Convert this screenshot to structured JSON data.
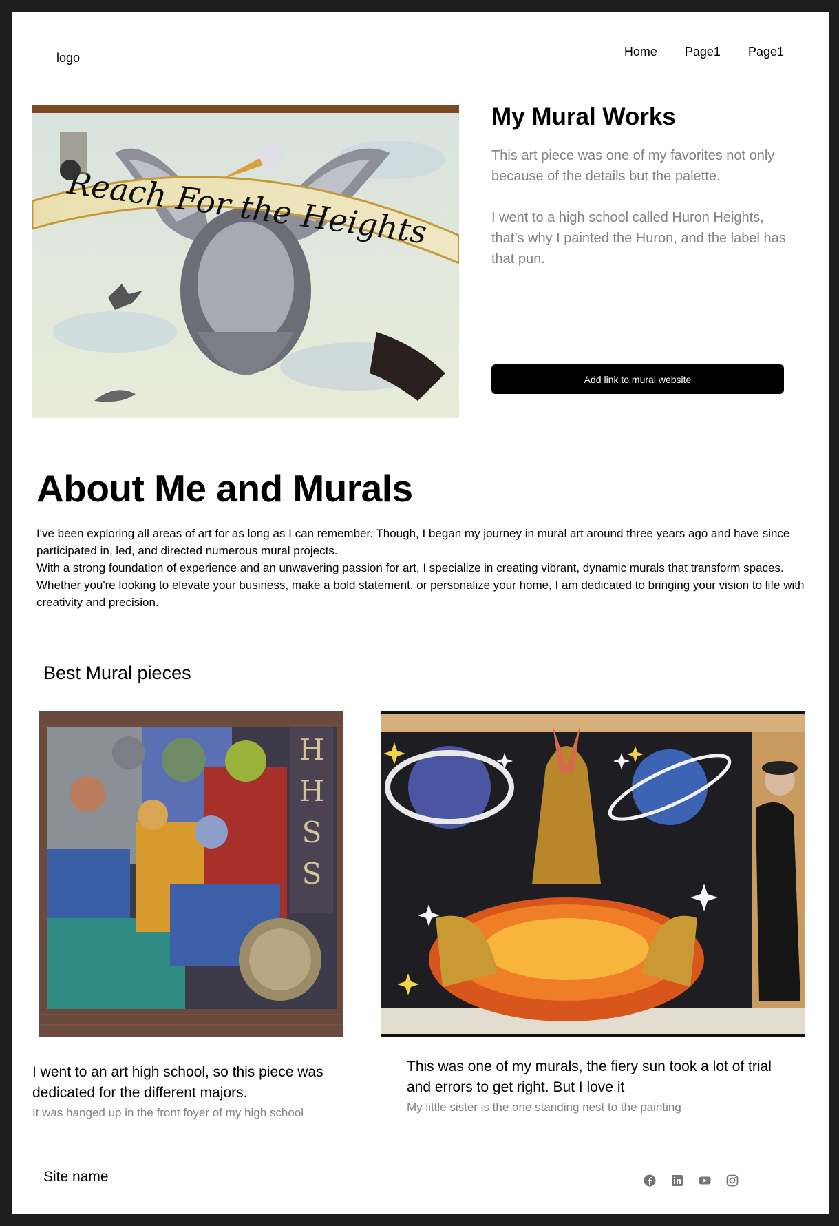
{
  "header": {
    "logo": "logo",
    "nav": [
      "Home",
      "Page1",
      "Page1"
    ]
  },
  "hero": {
    "image_text": "Reach For the Heights",
    "title": "My Mural Works",
    "paragraphs": [
      "This art piece was one of my favorites not only because of the details but the palette.",
      "I went to a high school called Huron Heights, that’s why I painted the Huron, and the label has that pun."
    ],
    "button_label": "Add link to mural website"
  },
  "about": {
    "title": "About Me and Murals",
    "paragraphs": [
      "I've been exploring all areas of art for as long as I can remember. Though, I began my journey in mural art around three years ago and have since participated in, led, and directed numerous mural projects.",
      "With a strong foundation of experience and an unwavering passion for art, I specialize in creating vibrant, dynamic murals that transform spaces. Whether you're looking to elevate your business, make a bold statement, or personalize your home, I am dedicated to bringing your vision to life with creativity and precision."
    ]
  },
  "best": {
    "title": "Best Mural pieces",
    "items": [
      {
        "caption": "I went to an art high school, so this piece was dedicated for the different majors.",
        "subcaption": "It was hanged up in the front foyer of my high school"
      },
      {
        "caption": "This was one of my murals, the fiery sun took a lot of trial and errors to get right. But I love it",
        "subcaption": "My little sister is the one standing nest to the painting"
      }
    ]
  },
  "footer": {
    "site_name": "Site name",
    "social_icons": [
      "facebook-icon",
      "linkedin-icon",
      "youtube-icon",
      "instagram-icon"
    ]
  },
  "colors": {
    "button_bg": "#000000",
    "muted_text": "#828282",
    "frame_bg": "#1e1e1e"
  }
}
